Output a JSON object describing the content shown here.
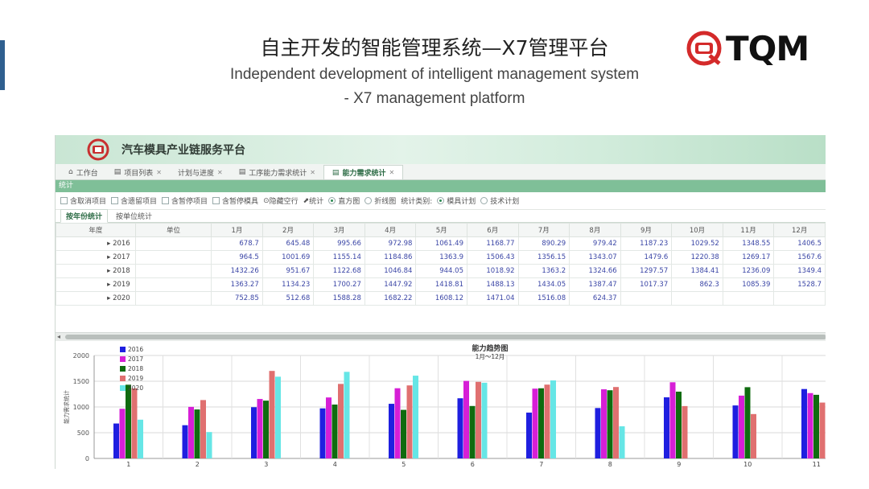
{
  "slide": {
    "title_cn": "自主开发的智能管理系统—X7管理平台",
    "title_en_line1": "Independent development of intelligent management system",
    "title_en_line2": "- X7 management platform",
    "logo_text": "TQM"
  },
  "app": {
    "title": "汽车模具产业链服务平台",
    "tabs": [
      {
        "label": "工作台",
        "closable": false,
        "active": false
      },
      {
        "label": "项目列表",
        "closable": true,
        "active": false
      },
      {
        "label": "计划与进度",
        "closable": true,
        "active": false
      },
      {
        "label": "工序能力需求统计",
        "closable": true,
        "active": false
      },
      {
        "label": "能力需求统计",
        "closable": true,
        "active": true
      }
    ],
    "section_label": "统计",
    "toolbar": {
      "cb1": "含取消项目",
      "cb2": "含遗留项目",
      "cb3": "含暂停项目",
      "cb4": "含暂停模具",
      "hide_empty": "隐藏空行",
      "stat_btn": "统计",
      "radio_bar": "直方图",
      "radio_line": "折线图",
      "category_label": "统计类别:",
      "radio_mold": "模具计划",
      "radio_tech": "技术计划"
    },
    "subtabs": [
      "按年份统计",
      "按单位统计"
    ],
    "table": {
      "headers": [
        "年度",
        "单位",
        "1月",
        "2月",
        "3月",
        "4月",
        "5月",
        "6月",
        "7月",
        "8月",
        "9月",
        "10月",
        "11月",
        "12月"
      ],
      "rows": [
        {
          "year": "2016",
          "values": [
            "678.7",
            "645.48",
            "995.66",
            "972.98",
            "1061.49",
            "1168.77",
            "890.29",
            "979.42",
            "1187.23",
            "1029.52",
            "1348.55",
            "1406.5"
          ]
        },
        {
          "year": "2017",
          "values": [
            "964.5",
            "1001.69",
            "1155.14",
            "1184.86",
            "1363.9",
            "1506.43",
            "1356.15",
            "1343.07",
            "1479.6",
            "1220.38",
            "1269.17",
            "1567.6"
          ]
        },
        {
          "year": "2018",
          "values": [
            "1432.26",
            "951.67",
            "1122.68",
            "1046.84",
            "944.05",
            "1018.92",
            "1363.2",
            "1324.66",
            "1297.57",
            "1384.41",
            "1236.09",
            "1349.4"
          ]
        },
        {
          "year": "2019",
          "values": [
            "1363.27",
            "1134.23",
            "1700.27",
            "1447.92",
            "1418.81",
            "1488.13",
            "1434.05",
            "1387.47",
            "1017.37",
            "862.3",
            "1085.39",
            "1528.7"
          ]
        },
        {
          "year": "2020",
          "values": [
            "752.85",
            "512.68",
            "1588.28",
            "1682.22",
            "1608.12",
            "1471.04",
            "1516.08",
            "624.37",
            "",
            "",
            "",
            ""
          ]
        }
      ]
    }
  },
  "chart_data": {
    "type": "bar",
    "title": "能力趋势图",
    "subtitle": "1月～12月",
    "ylabel": "能力需求统计",
    "ylim": [
      0,
      2000
    ],
    "yticks": [
      0,
      500,
      1000,
      1500,
      2000
    ],
    "categories": [
      "1",
      "2",
      "3",
      "4",
      "5",
      "6",
      "7",
      "8",
      "9",
      "10",
      "11"
    ],
    "series": [
      {
        "name": "2016",
        "color": "#1f1fe0",
        "values": [
          678.7,
          645.48,
          995.66,
          972.98,
          1061.49,
          1168.77,
          890.29,
          979.42,
          1187.23,
          1029.52,
          1348.55
        ]
      },
      {
        "name": "2017",
        "color": "#d61fd6",
        "values": [
          964.5,
          1001.69,
          1155.14,
          1184.86,
          1363.9,
          1506.43,
          1356.15,
          1343.07,
          1479.6,
          1220.38,
          1269.17
        ]
      },
      {
        "name": "2018",
        "color": "#0f6b0f",
        "values": [
          1432.26,
          951.67,
          1122.68,
          1046.84,
          944.05,
          1018.92,
          1363.2,
          1324.66,
          1297.57,
          1384.41,
          1236.09
        ]
      },
      {
        "name": "2019",
        "color": "#e07070",
        "values": [
          1363.27,
          1134.23,
          1700.27,
          1447.92,
          1418.81,
          1488.13,
          1434.05,
          1387.47,
          1017.37,
          862.3,
          1085.39
        ]
      },
      {
        "name": "2020",
        "color": "#66e6e6",
        "values": [
          752.85,
          512.68,
          1588.28,
          1682.22,
          1608.12,
          1471.04,
          1516.08,
          624.37,
          null,
          null,
          null
        ]
      }
    ],
    "legend_position": "top-left",
    "grid": true
  }
}
